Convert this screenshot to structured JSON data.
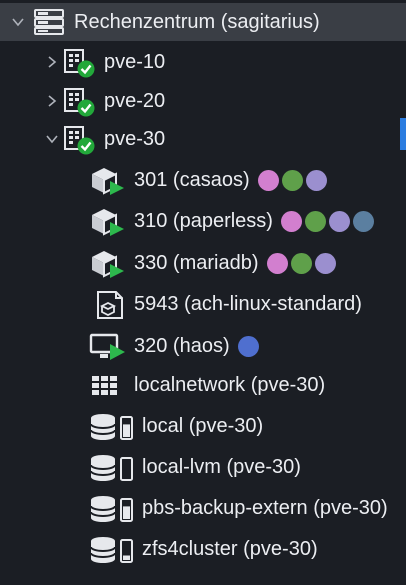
{
  "tree": {
    "root": {
      "label": "Rechenzentrum (sagitarius)"
    },
    "nodes": [
      {
        "label": "pve-10"
      },
      {
        "label": "pve-20"
      },
      {
        "label": "pve-30"
      }
    ],
    "guests": [
      {
        "label": "301 (casaos)",
        "tags": [
          "#d27fcf",
          "#5fa04a",
          "#9b8fcf"
        ]
      },
      {
        "label": "310 (paperless)",
        "tags": [
          "#d27fcf",
          "#5fa04a",
          "#9b8fcf",
          "#5b7fa0"
        ]
      },
      {
        "label": "330 (mariadb)",
        "tags": [
          "#d27fcf",
          "#5fa04a",
          "#9b8fcf"
        ]
      },
      {
        "label": "5943 (ach-linux-standard)",
        "tags": []
      },
      {
        "label": "320 (haos)",
        "tags": [
          "#4f6fcf"
        ]
      }
    ],
    "network": {
      "label": "localnetwork (pve-30)"
    },
    "storages": [
      {
        "label": "local (pve-30)",
        "bar_fill": 0.7
      },
      {
        "label": "local-lvm (pve-30)",
        "bar_fill": 0.0
      },
      {
        "label": "pbs-backup-extern (pve-30)",
        "bar_fill": 0.7
      },
      {
        "label": "zfs4cluster (pve-30)",
        "bar_fill": 0.25
      }
    ]
  },
  "colors": {
    "running": "#2db84d",
    "online": "#22a83a",
    "selected_accent": "#2b7de0"
  }
}
